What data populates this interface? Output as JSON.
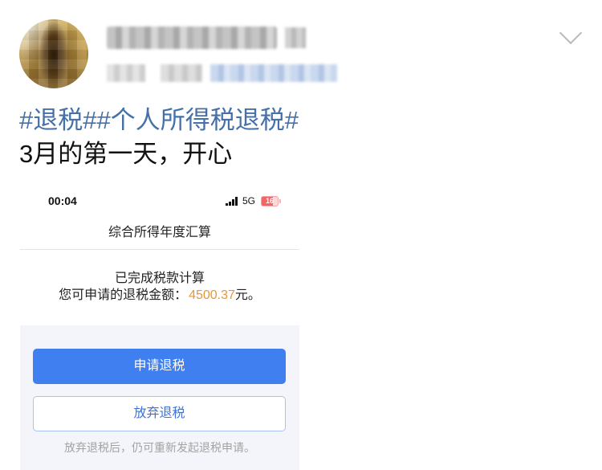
{
  "post": {
    "hashtags": [
      "#退税#",
      "#个人所得税退税#"
    ],
    "text": "3月的第一天，开心"
  },
  "attached_image": {
    "status_bar": {
      "time": "00:04",
      "network": "5G",
      "battery": "16"
    },
    "page_title": "综合所得年度汇算",
    "result_title": "已完成税款计算",
    "refund_label": "您可申请的退税金额：",
    "refund_amount": "4500.37",
    "refund_unit": "元。",
    "apply_button_label": "申请退税",
    "abandon_button_label": "放弃退税",
    "note": "放弃退税后，仍可重新发起退税申请。"
  },
  "icons": {
    "post_menu": "chevron-down-icon",
    "signal": "signal-icon",
    "battery": "battery-icon"
  },
  "colors": {
    "hashtag": "#4670a8",
    "primary_button": "#3f7ff0",
    "refund_amount": "#e8963a",
    "battery_low": "#f06767"
  }
}
